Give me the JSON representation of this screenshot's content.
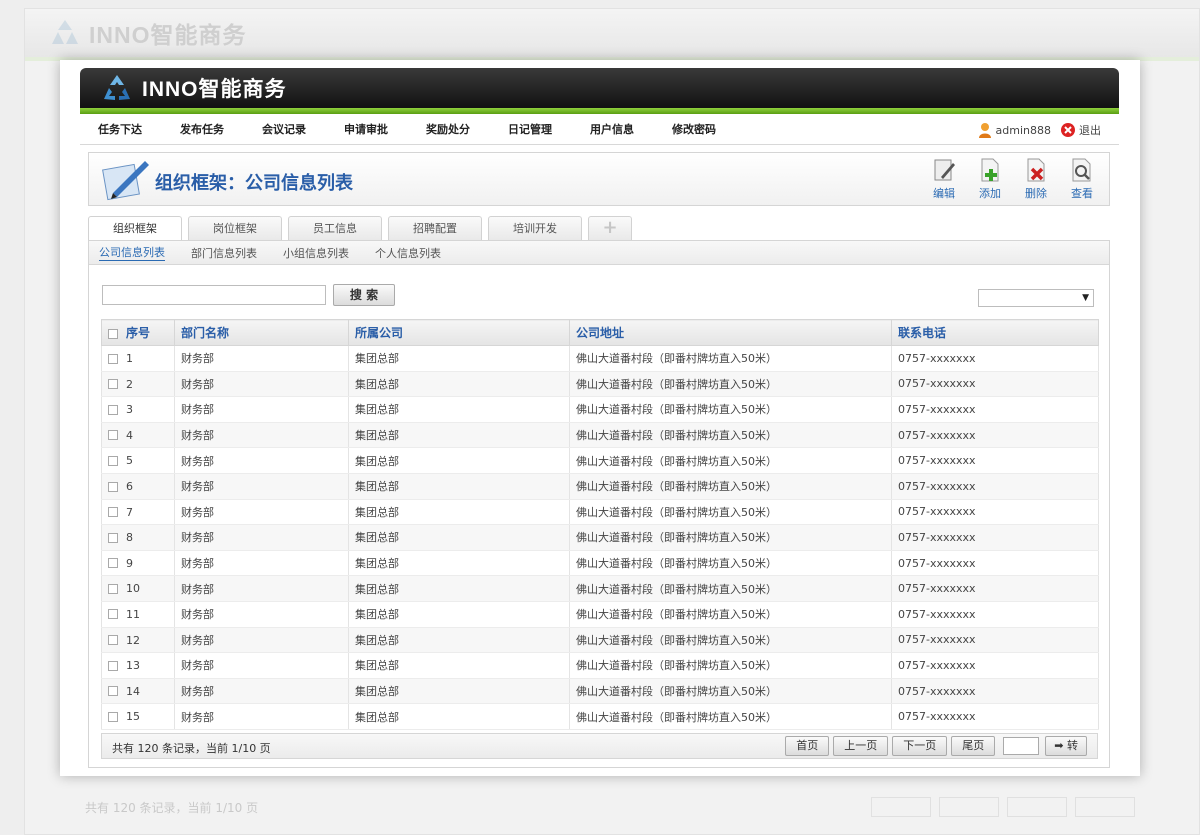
{
  "app": {
    "name": "INNO智能商务"
  },
  "nav": {
    "items": [
      "任务下达",
      "发布任务",
      "会议记录",
      "申请审批",
      "奖励处分",
      "日记管理",
      "用户信息",
      "修改密码"
    ],
    "user": "admin888",
    "logout": "退出"
  },
  "page": {
    "title": "组织框架：公司信息列表"
  },
  "toolbar": {
    "edit": "编辑",
    "add": "添加",
    "delete": "删除",
    "view": "查看"
  },
  "tabs": [
    "组织框架",
    "岗位框架",
    "员工信息",
    "招聘配置",
    "培训开发"
  ],
  "subtabs": [
    "公司信息列表",
    "部门信息列表",
    "小组信息列表",
    "个人信息列表"
  ],
  "search": {
    "button": "搜 索",
    "value": ""
  },
  "table": {
    "columns": [
      "序号",
      "部门名称",
      "所属公司",
      "公司地址",
      "联系电话"
    ],
    "rows": [
      [
        "1",
        "财务部",
        "集团总部",
        "佛山大道番村段（即番村牌坊直入50米）",
        "0757-xxxxxxx"
      ],
      [
        "2",
        "财务部",
        "集团总部",
        "佛山大道番村段（即番村牌坊直入50米）",
        "0757-xxxxxxx"
      ],
      [
        "3",
        "财务部",
        "集团总部",
        "佛山大道番村段（即番村牌坊直入50米）",
        "0757-xxxxxxx"
      ],
      [
        "4",
        "财务部",
        "集团总部",
        "佛山大道番村段（即番村牌坊直入50米）",
        "0757-xxxxxxx"
      ],
      [
        "5",
        "财务部",
        "集团总部",
        "佛山大道番村段（即番村牌坊直入50米）",
        "0757-xxxxxxx"
      ],
      [
        "6",
        "财务部",
        "集团总部",
        "佛山大道番村段（即番村牌坊直入50米）",
        "0757-xxxxxxx"
      ],
      [
        "7",
        "财务部",
        "集团总部",
        "佛山大道番村段（即番村牌坊直入50米）",
        "0757-xxxxxxx"
      ],
      [
        "8",
        "财务部",
        "集团总部",
        "佛山大道番村段（即番村牌坊直入50米）",
        "0757-xxxxxxx"
      ],
      [
        "9",
        "财务部",
        "集团总部",
        "佛山大道番村段（即番村牌坊直入50米）",
        "0757-xxxxxxx"
      ],
      [
        "10",
        "财务部",
        "集团总部",
        "佛山大道番村段（即番村牌坊直入50米）",
        "0757-xxxxxxx"
      ],
      [
        "11",
        "财务部",
        "集团总部",
        "佛山大道番村段（即番村牌坊直入50米）",
        "0757-xxxxxxx"
      ],
      [
        "12",
        "财务部",
        "集团总部",
        "佛山大道番村段（即番村牌坊直入50米）",
        "0757-xxxxxxx"
      ],
      [
        "13",
        "财务部",
        "集团总部",
        "佛山大道番村段（即番村牌坊直入50米）",
        "0757-xxxxxxx"
      ],
      [
        "14",
        "财务部",
        "集团总部",
        "佛山大道番村段（即番村牌坊直入50米）",
        "0757-xxxxxxx"
      ],
      [
        "15",
        "财务部",
        "集团总部",
        "佛山大道番村段（即番村牌坊直入50米）",
        "0757-xxxxxxx"
      ]
    ]
  },
  "footer": {
    "info": "共有 120 条记录，当前 1/10 页",
    "first": "首页",
    "prev": "上一页",
    "next": "下一页",
    "last": "尾页",
    "go": "➡ 转"
  },
  "colors": {
    "accent": "#2a5ea8",
    "brand_bar": "#6db01e",
    "header_bg": "#1a1a1a"
  }
}
